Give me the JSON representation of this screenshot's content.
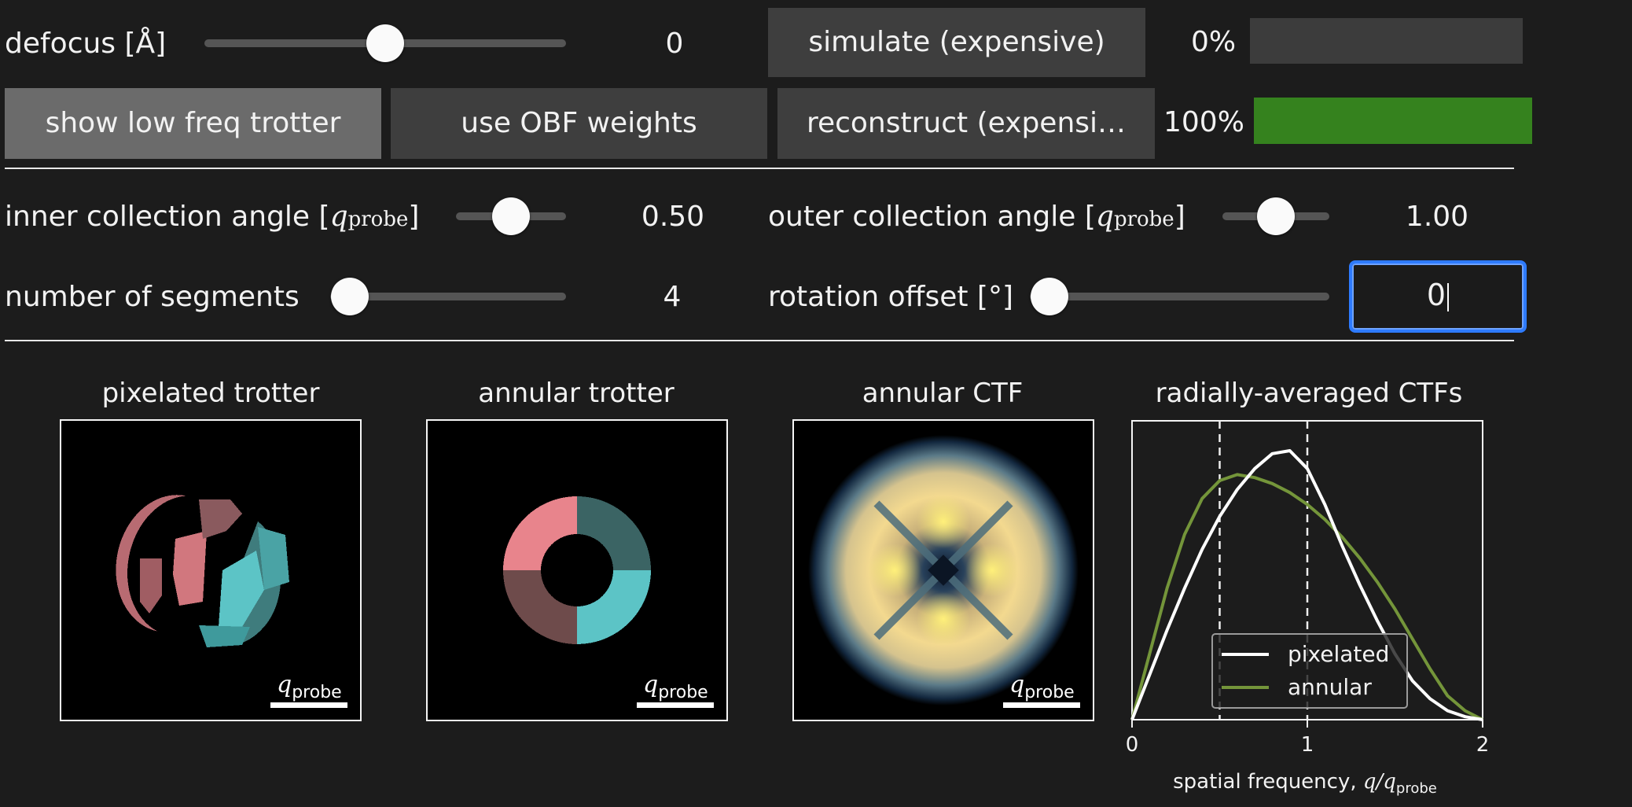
{
  "controls": {
    "defocus": {
      "label": "defocus [Å]",
      "value": "0",
      "slider_fraction": 0.5
    },
    "simulate_button": "simulate (expensive)",
    "simulate_progress": {
      "text": "0%",
      "fraction": 0
    },
    "toggle_buttons": [
      "show low freq trotter",
      "use OBF weights"
    ],
    "reconstruct_button": "reconstruct (expensi…",
    "reconstruct_progress": {
      "text": "100%",
      "fraction": 1.0
    },
    "inner_angle": {
      "label_text": "inner collection angle [",
      "label_sym": "q",
      "label_sub": "probe",
      "label_close": "]",
      "value": "0.50",
      "slider_fraction": 0.5
    },
    "outer_angle": {
      "label_text": "outer collection angle [",
      "label_sym": "q",
      "label_sub": "probe",
      "label_close": "]",
      "value": "1.00",
      "slider_fraction": 0.5
    },
    "segments": {
      "label": "number of segments",
      "value": "4",
      "slider_fraction": 0
    },
    "rotation": {
      "label": "rotation offset [°]",
      "value": "0",
      "slider_fraction": 0
    }
  },
  "colors": {
    "background": "#1c1c1c",
    "button": "#3e3e3e",
    "button_active": "#6b6b6b",
    "progress_track": "#3c3c3c",
    "progress_fill": "#35821e",
    "focus_border": "#2e7bff",
    "pink": "#e8848c",
    "pink_dark": "#6e4b4b",
    "cyan": "#5cc4c6",
    "cyan_dark": "#3b6464",
    "series_pixelated": "#ffffff",
    "series_annular": "#74953a"
  },
  "panels": {
    "titles": [
      "pixelated trotter",
      "annular trotter",
      "annular CTF",
      "radially-averaged CTFs"
    ],
    "scalebar_sym": "q",
    "scalebar_sub": "probe"
  },
  "chart_data": {
    "type": "line",
    "title": "radially-averaged CTFs",
    "xlabel_text": "spatial frequency, ",
    "xlabel_sym": "q/q",
    "xlabel_sub": "probe",
    "xlim": [
      0,
      2
    ],
    "ylim": [
      0,
      1
    ],
    "xticks": [
      "0",
      "1",
      "2"
    ],
    "vlines": [
      0.5,
      1.0
    ],
    "legend_position": "lower-center",
    "series": [
      {
        "name": "pixelated",
        "x": [
          0,
          0.1,
          0.2,
          0.3,
          0.4,
          0.5,
          0.6,
          0.7,
          0.8,
          0.9,
          1.0,
          1.1,
          1.2,
          1.3,
          1.4,
          1.5,
          1.6,
          1.7,
          1.8,
          1.9,
          2.0
        ],
        "y": [
          0,
          0.15,
          0.3,
          0.44,
          0.57,
          0.68,
          0.77,
          0.84,
          0.89,
          0.9,
          0.84,
          0.72,
          0.58,
          0.45,
          0.33,
          0.22,
          0.13,
          0.07,
          0.03,
          0.01,
          0
        ]
      },
      {
        "name": "annular",
        "x": [
          0,
          0.1,
          0.2,
          0.3,
          0.4,
          0.5,
          0.6,
          0.7,
          0.8,
          0.9,
          1.0,
          1.1,
          1.2,
          1.3,
          1.4,
          1.5,
          1.6,
          1.7,
          1.8,
          1.9,
          2.0
        ],
        "y": [
          0,
          0.22,
          0.44,
          0.62,
          0.74,
          0.8,
          0.82,
          0.81,
          0.79,
          0.76,
          0.72,
          0.67,
          0.61,
          0.54,
          0.46,
          0.37,
          0.27,
          0.17,
          0.08,
          0.03,
          0
        ]
      }
    ]
  }
}
